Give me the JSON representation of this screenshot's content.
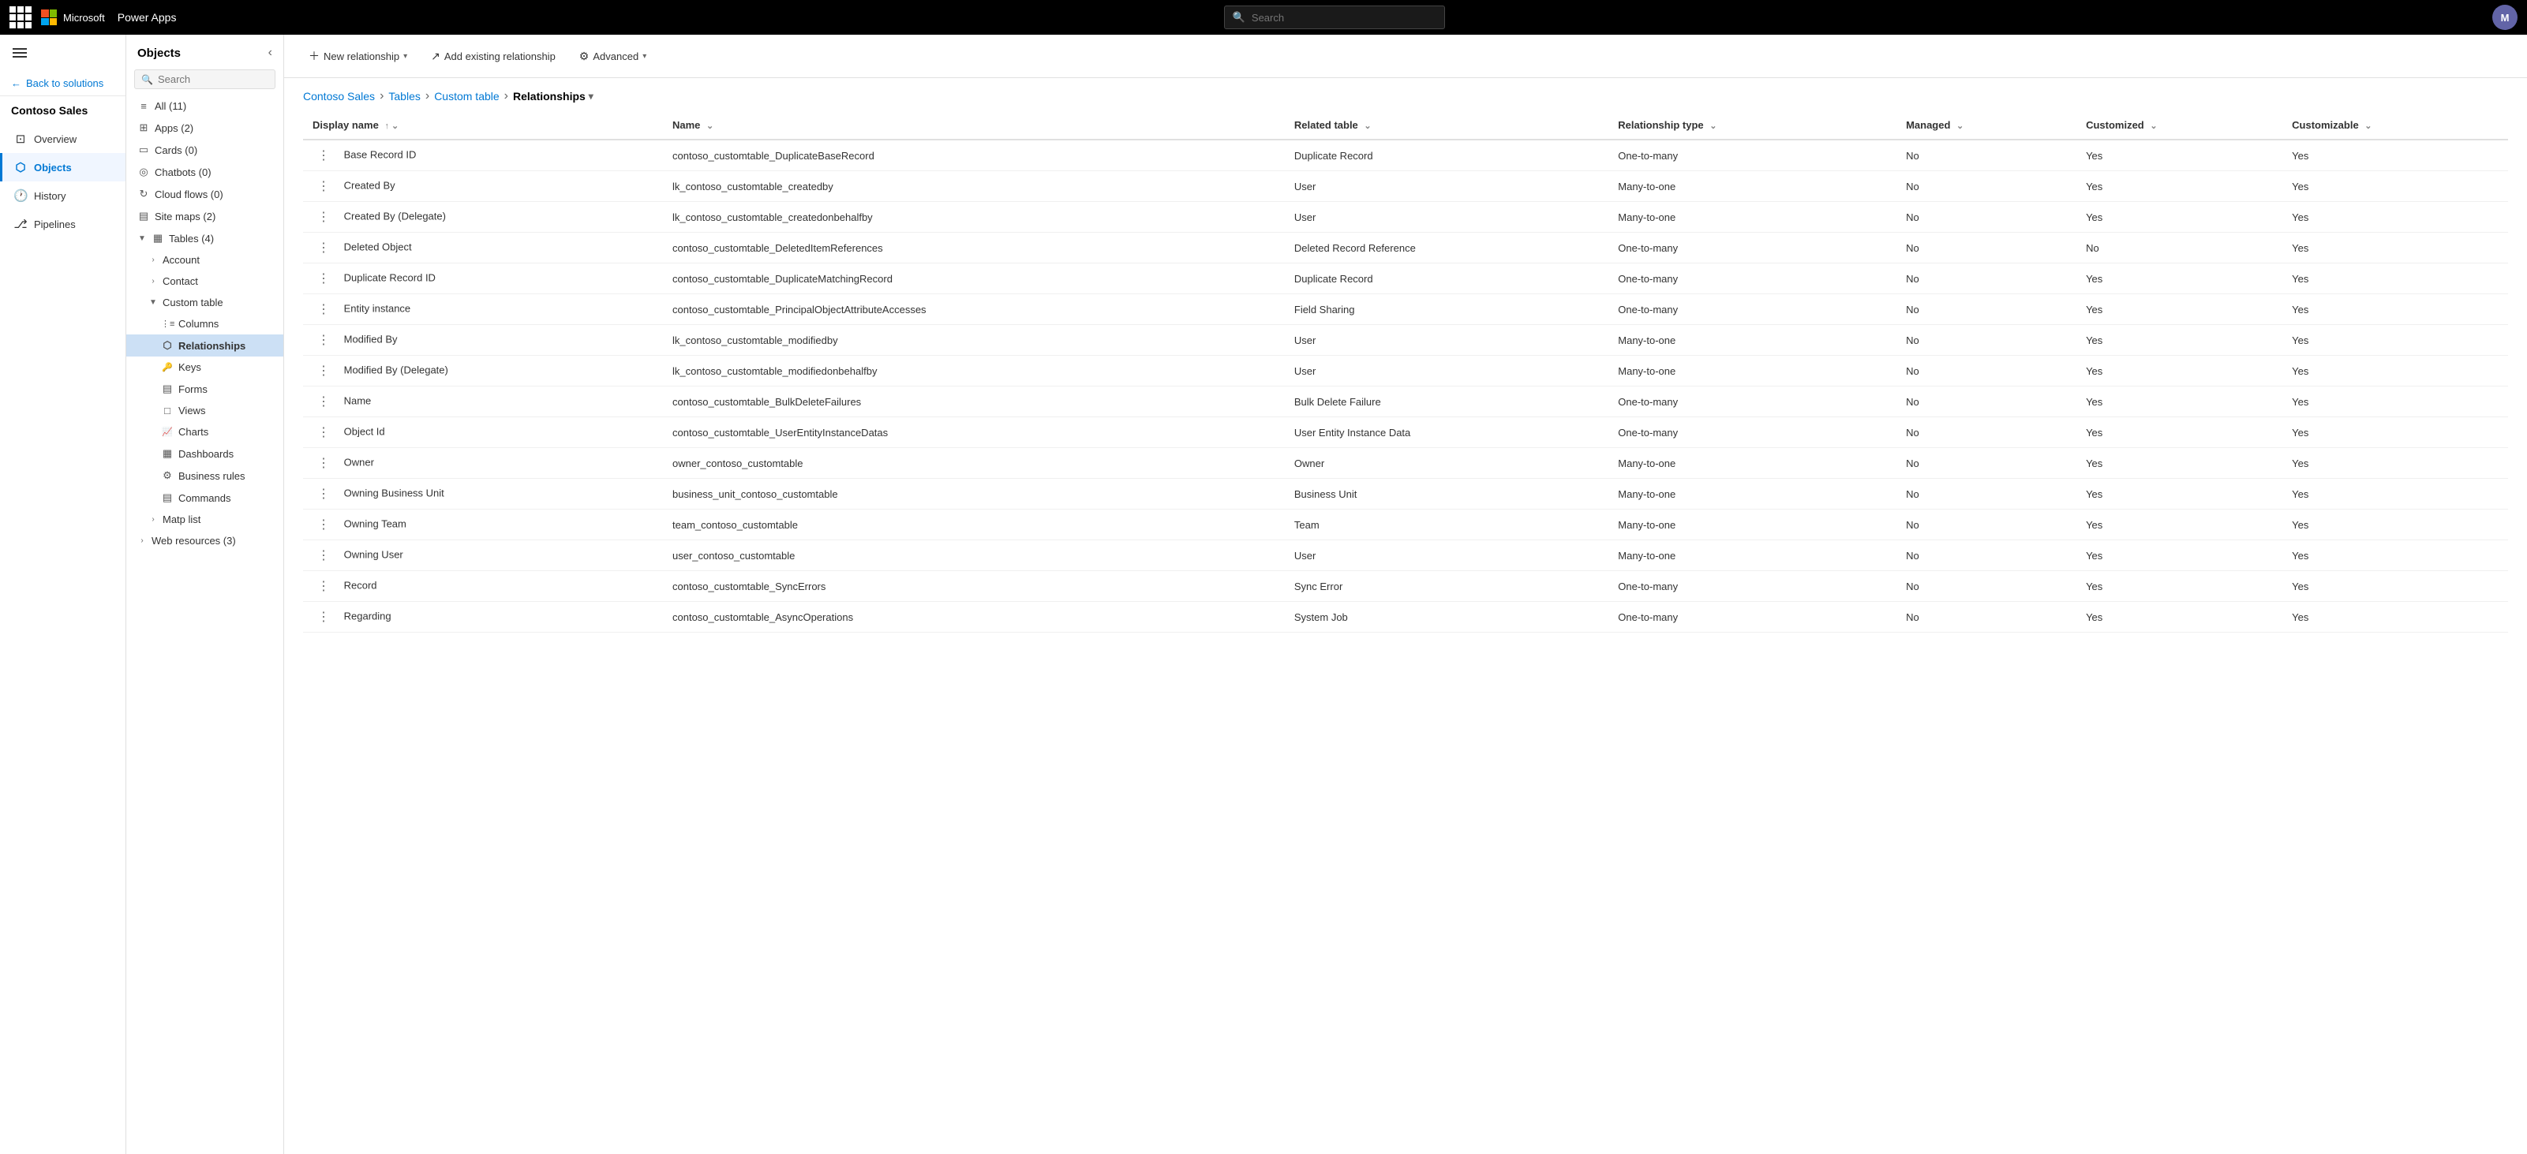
{
  "topbar": {
    "product": "Power Apps",
    "search_placeholder": "Search",
    "avatar_initials": "M"
  },
  "left_nav": {
    "solution_name": "Contoso Sales",
    "back_label": "Back to solutions",
    "items": [
      {
        "id": "overview",
        "label": "Overview",
        "icon": "⊡"
      },
      {
        "id": "objects",
        "label": "Objects",
        "icon": "⬡",
        "active": true
      },
      {
        "id": "history",
        "label": "History",
        "icon": "🕐"
      },
      {
        "id": "pipelines",
        "label": "Pipelines",
        "icon": "⎇"
      }
    ]
  },
  "objects_panel": {
    "title": "Objects",
    "search_placeholder": "Search",
    "items": [
      {
        "id": "all",
        "label": "All (11)",
        "icon": "≡",
        "level": 0
      },
      {
        "id": "apps",
        "label": "Apps (2)",
        "icon": "⊞",
        "level": 0
      },
      {
        "id": "cards",
        "label": "Cards (0)",
        "icon": "▭",
        "level": 0
      },
      {
        "id": "chatbots",
        "label": "Chatbots (0)",
        "icon": "◎",
        "level": 0
      },
      {
        "id": "cloudflows",
        "label": "Cloud flows (0)",
        "icon": "↻",
        "level": 0
      },
      {
        "id": "sitemaps",
        "label": "Site maps (2)",
        "icon": "▤",
        "level": 0
      },
      {
        "id": "tables",
        "label": "Tables (4)",
        "icon": "▦",
        "level": 0,
        "expanded": true
      },
      {
        "id": "account",
        "label": "Account",
        "icon": "",
        "level": 1,
        "expandable": true
      },
      {
        "id": "contact",
        "label": "Contact",
        "icon": "",
        "level": 1,
        "expandable": true
      },
      {
        "id": "customtable",
        "label": "Custom table",
        "icon": "",
        "level": 1,
        "expanded": true
      },
      {
        "id": "columns",
        "label": "Columns",
        "icon": "⋮≡",
        "level": 2
      },
      {
        "id": "relationships",
        "label": "Relationships",
        "icon": "⬡",
        "level": 2,
        "active": true
      },
      {
        "id": "keys",
        "label": "Keys",
        "icon": "🔑",
        "level": 2
      },
      {
        "id": "forms",
        "label": "Forms",
        "icon": "▤",
        "level": 2
      },
      {
        "id": "views",
        "label": "Views",
        "icon": "□",
        "level": 2
      },
      {
        "id": "charts",
        "label": "Charts",
        "icon": "📈",
        "level": 2
      },
      {
        "id": "dashboards",
        "label": "Dashboards",
        "icon": "▦",
        "level": 2
      },
      {
        "id": "businessrules",
        "label": "Business rules",
        "icon": "⚙",
        "level": 2
      },
      {
        "id": "commands",
        "label": "Commands",
        "icon": "▤",
        "level": 2
      },
      {
        "id": "maplist",
        "label": "Matp list",
        "icon": "",
        "level": 1,
        "expandable": true
      },
      {
        "id": "webresources",
        "label": "Web resources (3)",
        "icon": "",
        "level": 0,
        "expandable": true
      }
    ]
  },
  "toolbar": {
    "new_relationship": "New relationship",
    "add_existing": "Add existing relationship",
    "advanced": "Advanced"
  },
  "breadcrumb": {
    "items": [
      {
        "id": "contoso",
        "label": "Contoso Sales"
      },
      {
        "id": "tables",
        "label": "Tables"
      },
      {
        "id": "customtable",
        "label": "Custom table"
      }
    ],
    "current": "Relationships"
  },
  "table": {
    "columns": [
      {
        "id": "display_name",
        "label": "Display name"
      },
      {
        "id": "name",
        "label": "Name"
      },
      {
        "id": "related_table",
        "label": "Related table"
      },
      {
        "id": "relationship_type",
        "label": "Relationship type"
      },
      {
        "id": "managed",
        "label": "Managed"
      },
      {
        "id": "customized",
        "label": "Customized"
      },
      {
        "id": "customizable",
        "label": "Customizable"
      }
    ],
    "rows": [
      {
        "display_name": "Base Record ID",
        "name": "contoso_customtable_DuplicateBaseRecord",
        "related_table": "Duplicate Record",
        "relationship_type": "One-to-many",
        "managed": "No",
        "customized": "Yes",
        "customizable": "Yes"
      },
      {
        "display_name": "Created By",
        "name": "lk_contoso_customtable_createdby",
        "related_table": "User",
        "relationship_type": "Many-to-one",
        "managed": "No",
        "customized": "Yes",
        "customizable": "Yes"
      },
      {
        "display_name": "Created By (Delegate)",
        "name": "lk_contoso_customtable_createdonbehalfby",
        "related_table": "User",
        "relationship_type": "Many-to-one",
        "managed": "No",
        "customized": "Yes",
        "customizable": "Yes"
      },
      {
        "display_name": "Deleted Object",
        "name": "contoso_customtable_DeletedItemReferences",
        "related_table": "Deleted Record Reference",
        "relationship_type": "One-to-many",
        "managed": "No",
        "customized": "No",
        "customizable": "Yes"
      },
      {
        "display_name": "Duplicate Record ID",
        "name": "contoso_customtable_DuplicateMatchingRecord",
        "related_table": "Duplicate Record",
        "relationship_type": "One-to-many",
        "managed": "No",
        "customized": "Yes",
        "customizable": "Yes"
      },
      {
        "display_name": "Entity instance",
        "name": "contoso_customtable_PrincipalObjectAttributeAccesses",
        "related_table": "Field Sharing",
        "relationship_type": "One-to-many",
        "managed": "No",
        "customized": "Yes",
        "customizable": "Yes"
      },
      {
        "display_name": "Modified By",
        "name": "lk_contoso_customtable_modifiedby",
        "related_table": "User",
        "relationship_type": "Many-to-one",
        "managed": "No",
        "customized": "Yes",
        "customizable": "Yes"
      },
      {
        "display_name": "Modified By (Delegate)",
        "name": "lk_contoso_customtable_modifiedonbehalfby",
        "related_table": "User",
        "relationship_type": "Many-to-one",
        "managed": "No",
        "customized": "Yes",
        "customizable": "Yes"
      },
      {
        "display_name": "Name",
        "name": "contoso_customtable_BulkDeleteFailures",
        "related_table": "Bulk Delete Failure",
        "relationship_type": "One-to-many",
        "managed": "No",
        "customized": "Yes",
        "customizable": "Yes"
      },
      {
        "display_name": "Object Id",
        "name": "contoso_customtable_UserEntityInstanceDatas",
        "related_table": "User Entity Instance Data",
        "relationship_type": "One-to-many",
        "managed": "No",
        "customized": "Yes",
        "customizable": "Yes"
      },
      {
        "display_name": "Owner",
        "name": "owner_contoso_customtable",
        "related_table": "Owner",
        "relationship_type": "Many-to-one",
        "managed": "No",
        "customized": "Yes",
        "customizable": "Yes"
      },
      {
        "display_name": "Owning Business Unit",
        "name": "business_unit_contoso_customtable",
        "related_table": "Business Unit",
        "relationship_type": "Many-to-one",
        "managed": "No",
        "customized": "Yes",
        "customizable": "Yes"
      },
      {
        "display_name": "Owning Team",
        "name": "team_contoso_customtable",
        "related_table": "Team",
        "relationship_type": "Many-to-one",
        "managed": "No",
        "customized": "Yes",
        "customizable": "Yes"
      },
      {
        "display_name": "Owning User",
        "name": "user_contoso_customtable",
        "related_table": "User",
        "relationship_type": "Many-to-one",
        "managed": "No",
        "customized": "Yes",
        "customizable": "Yes"
      },
      {
        "display_name": "Record",
        "name": "contoso_customtable_SyncErrors",
        "related_table": "Sync Error",
        "relationship_type": "One-to-many",
        "managed": "No",
        "customized": "Yes",
        "customizable": "Yes"
      },
      {
        "display_name": "Regarding",
        "name": "contoso_customtable_AsyncOperations",
        "related_table": "System Job",
        "relationship_type": "One-to-many",
        "managed": "No",
        "customized": "Yes",
        "customizable": "Yes"
      }
    ]
  }
}
